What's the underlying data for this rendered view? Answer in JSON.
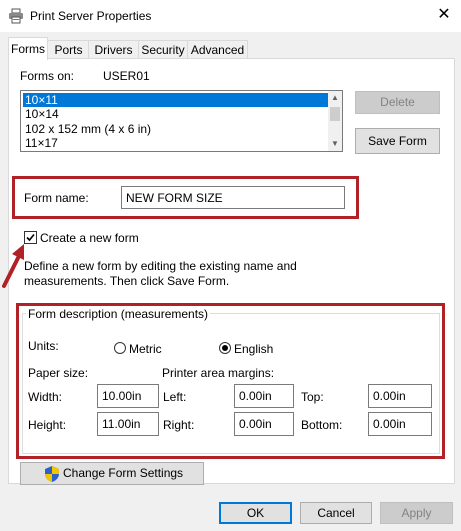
{
  "window": {
    "title": "Print Server Properties",
    "close_glyph": "✕"
  },
  "tabs": [
    {
      "label": "Forms",
      "active": true
    },
    {
      "label": "Ports"
    },
    {
      "label": "Drivers"
    },
    {
      "label": "Security"
    },
    {
      "label": "Advanced"
    }
  ],
  "forms_on": {
    "label": "Forms on:",
    "server": "USER01"
  },
  "forms_list": {
    "items": [
      "10×11",
      "10×14",
      "102 x 152 mm (4 x 6 in)",
      "11×17"
    ],
    "selected_index": 0
  },
  "buttons": {
    "delete": "Delete",
    "save_form": "Save Form",
    "change_settings": "Change Form Settings",
    "ok": "OK",
    "cancel": "Cancel",
    "apply": "Apply"
  },
  "form_name": {
    "label": "Form name:",
    "value": "NEW FORM SIZE"
  },
  "create_new": {
    "label": "Create a new form",
    "checked": true
  },
  "hint": {
    "line1": "Define a new form by editing the existing name and",
    "line2": "measurements. Then click Save Form."
  },
  "description": {
    "title": "Form description (measurements)",
    "units_label": "Units:",
    "metric_label": "Metric",
    "english_label": "English",
    "selected_unit": "English",
    "paper_size_label": "Paper size:",
    "printer_margins_label": "Printer area margins:",
    "width_label": "Width:",
    "height_label": "Height:",
    "left_label": "Left:",
    "right_label": "Right:",
    "top_label": "Top:",
    "bottom_label": "Bottom:",
    "width_value": "10.00in",
    "height_value": "11.00in",
    "left_value": "0.00in",
    "right_value": "0.00in",
    "top_value": "0.00in",
    "bottom_value": "0.00in"
  },
  "colors": {
    "highlight": "#b02226",
    "selection": "#0078d7"
  }
}
